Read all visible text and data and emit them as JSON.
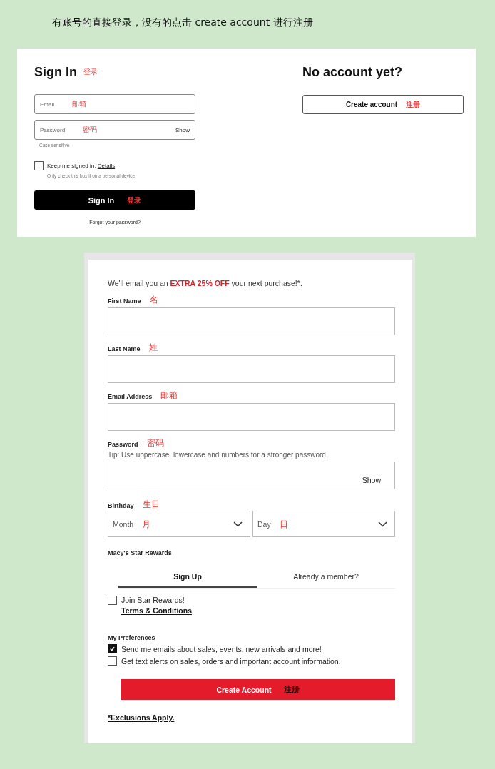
{
  "caption": "有账号的直接登录，没有的点击 create account 进行注册",
  "signin": {
    "title": "Sign In",
    "title_note": "登录",
    "fields": [
      {
        "placeholder": "Email",
        "note": "邮箱"
      },
      {
        "placeholder": "Password",
        "note": "密码",
        "action": "Show"
      }
    ],
    "hint": "Case sensitive",
    "keep": {
      "label": "Keep me signed in.",
      "link": "Details",
      "checked": false,
      "hint": "Only check this box if on a personal device"
    },
    "button": {
      "label": "Sign In",
      "note": "登录"
    },
    "forgot": "Forgot your password?"
  },
  "new_account": {
    "title": "No account yet?",
    "button": {
      "label": "Create account",
      "note": "注册"
    }
  },
  "register": {
    "promo": "We'll email you an **EXTRA 25% OFF** your next purchase!*.",
    "fields": [
      {
        "label": "First Name",
        "note": "名"
      },
      {
        "label": "Last Name",
        "note": "姓"
      },
      {
        "label": "Email Address",
        "note": "邮箱"
      },
      {
        "label": "Password",
        "note": "密码",
        "tip": "Tip: Use uppercase, lowercase and numbers for a stronger password.",
        "action": "Show"
      }
    ],
    "birthday": {
      "label": "Birthday",
      "note": "生日",
      "selects": [
        {
          "placeholder": "Month",
          "note": "月"
        },
        {
          "placeholder": "Day",
          "note": "日"
        }
      ]
    },
    "rewards": {
      "title": "Macy's Star Rewards",
      "tabs": [
        {
          "label": "Sign Up",
          "selected": true
        },
        {
          "label": "Already a member?",
          "selected": false
        }
      ],
      "join": {
        "label": "Join Star Rewards!",
        "checked": false
      },
      "terms": "Terms & Conditions"
    },
    "preferences": {
      "title": "My Preferences",
      "items": [
        {
          "label": "Send me emails about sales, events, new arrivals and more!",
          "checked": true
        },
        {
          "label": "Get text alerts on sales, orders and important account information.",
          "checked": false
        }
      ]
    },
    "button": {
      "label": "Create Account",
      "note": "注册"
    },
    "exclusions": "*Exclusions Apply."
  }
}
